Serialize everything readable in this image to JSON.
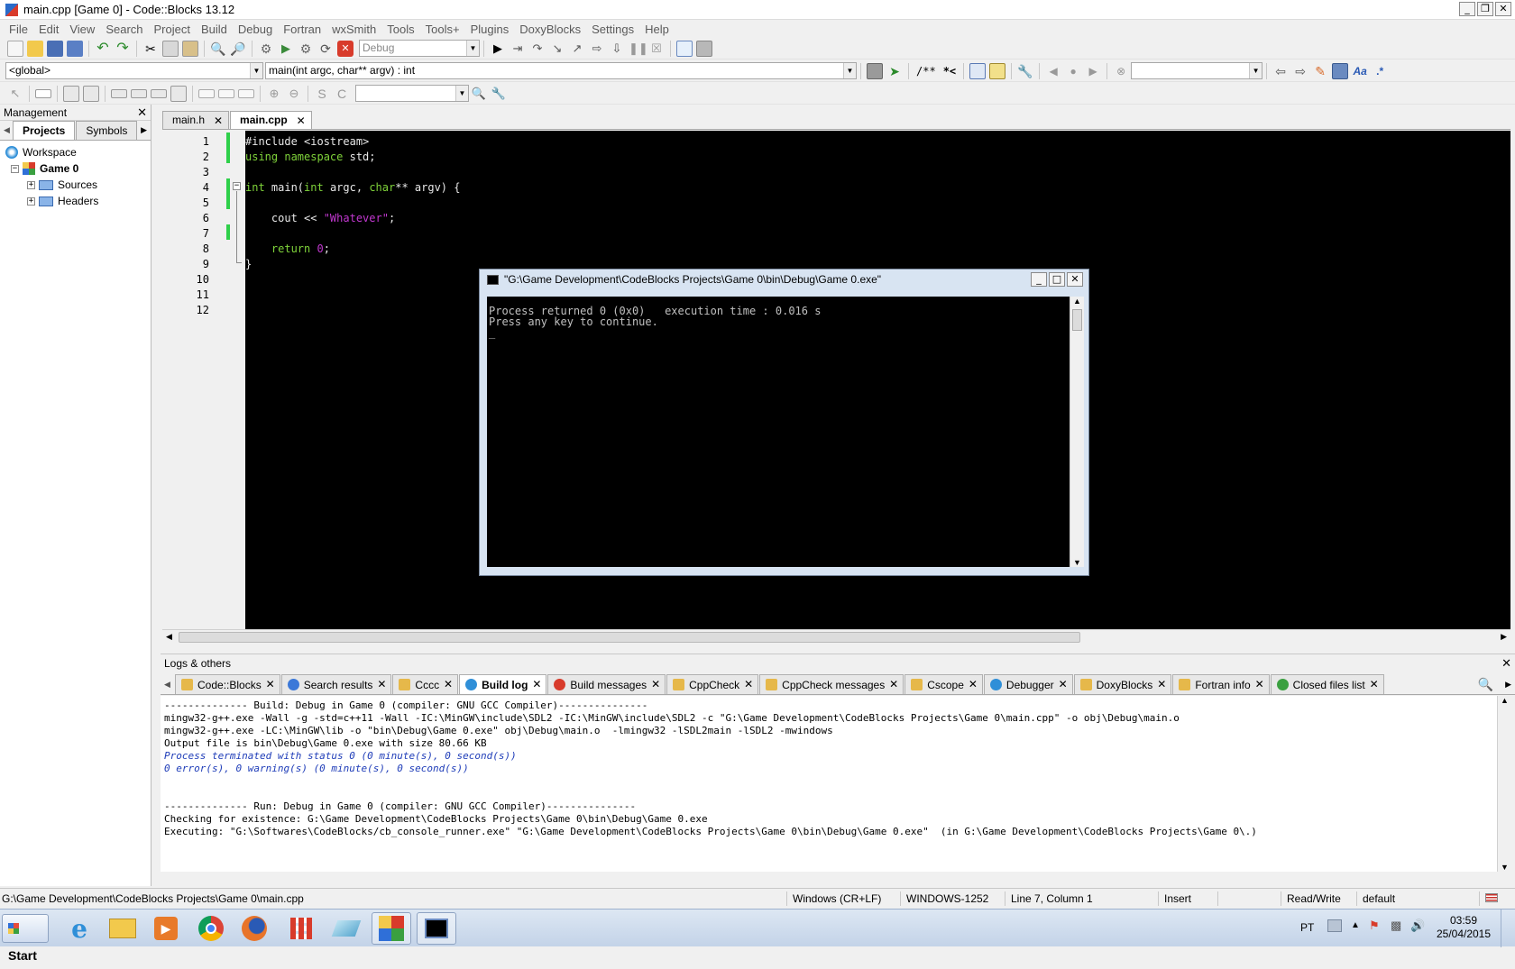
{
  "window": {
    "title": "main.cpp [Game 0] - Code::Blocks 13.12",
    "controls": [
      "_",
      "❐",
      "✕"
    ]
  },
  "menu": [
    "File",
    "Edit",
    "View",
    "Search",
    "Project",
    "Build",
    "Debug",
    "Fortran",
    "wxSmith",
    "Tools",
    "Tools+",
    "Plugins",
    "DoxyBlocks",
    "Settings",
    "Help"
  ],
  "toolbar": {
    "build_target": "Debug",
    "scope": "<global>",
    "function": "main(int argc, char** argv) : int",
    "comment_block": "/**",
    "comment_line": "*<",
    "search_value": "",
    "widget_value": ""
  },
  "management": {
    "title": "Management",
    "close": "✕",
    "tabs": [
      "Projects",
      "Symbols"
    ],
    "active_tab": "Projects",
    "tree": {
      "workspace": "Workspace",
      "project": "Game 0",
      "folders": [
        "Sources",
        "Headers"
      ]
    }
  },
  "editor": {
    "tabs": [
      {
        "label": "main.h",
        "active": false
      },
      {
        "label": "main.cpp",
        "active": true
      }
    ],
    "line_numbers": [
      "1",
      "2",
      "3",
      "4",
      "5",
      "6",
      "7",
      "8",
      "9",
      "10",
      "11",
      "12"
    ],
    "code": {
      "l1": "#include <iostream>",
      "l2_kw": "using namespace",
      "l2_rest": " std;",
      "l4_kw1": "int",
      "l4_a": " main(",
      "l4_kw2": "int",
      "l4_b": " argc, ",
      "l4_kw3": "char",
      "l4_c": "** argv) {",
      "l6_a": "    cout << ",
      "l6_str": "\"Whatever\"",
      "l6_b": ";",
      "l8_kw": "    return",
      "l8_num": " 0",
      "l8_b": ";",
      "l9": "}"
    }
  },
  "console": {
    "title": "\"G:\\Game Development\\CodeBlocks Projects\\Game 0\\bin\\Debug\\Game 0.exe\"",
    "line1": "Process returned 0 (0x0)   execution time : 0.016 s",
    "line2": "Press any key to continue.",
    "cursor": "_"
  },
  "logs": {
    "title": "Logs & others",
    "close": "✕",
    "tabs": [
      {
        "label": "Code::Blocks",
        "icon": "edit-icon",
        "color": "#e6b84a",
        "active": false
      },
      {
        "label": "Search results",
        "icon": "search-icon",
        "color": "#3b78d8",
        "active": false
      },
      {
        "label": "Cccc",
        "icon": "edit-icon",
        "color": "#e6b84a",
        "active": false
      },
      {
        "label": "Build log",
        "icon": "gear-icon",
        "color": "#2f8fd8",
        "active": true
      },
      {
        "label": "Build messages",
        "icon": "pin-icon",
        "color": "#d83b2b",
        "active": false
      },
      {
        "label": "CppCheck",
        "icon": "edit-icon",
        "color": "#e6b84a",
        "active": false
      },
      {
        "label": "CppCheck messages",
        "icon": "edit-icon",
        "color": "#e6b84a",
        "active": false
      },
      {
        "label": "Cscope",
        "icon": "edit-icon",
        "color": "#e6b84a",
        "active": false
      },
      {
        "label": "Debugger",
        "icon": "gear-icon",
        "color": "#2f8fd8",
        "active": false
      },
      {
        "label": "DoxyBlocks",
        "icon": "edit-icon",
        "color": "#e6b84a",
        "active": false
      },
      {
        "label": "Fortran info",
        "icon": "edit-icon",
        "color": "#e6b84a",
        "active": false
      },
      {
        "label": "Closed files list",
        "icon": "refresh-icon",
        "color": "#3aa040",
        "active": false
      }
    ],
    "lines": [
      {
        "text": "-------------- Build: Debug in Game 0 (compiler: GNU GCC Compiler)---------------",
        "style": "normal"
      },
      {
        "text": "mingw32-g++.exe -Wall -g -std=c++11 -Wall -IC:\\MinGW\\include\\SDL2 -IC:\\MinGW\\include\\SDL2 -c \"G:\\Game Development\\CodeBlocks Projects\\Game 0\\main.cpp\" -o obj\\Debug\\main.o",
        "style": "normal"
      },
      {
        "text": "mingw32-g++.exe -LC:\\MinGW\\lib -o \"bin\\Debug\\Game 0.exe\" obj\\Debug\\main.o  -lmingw32 -lSDL2main -lSDL2 -mwindows",
        "style": "normal"
      },
      {
        "text": "Output file is bin\\Debug\\Game 0.exe with size 80.66 KB",
        "style": "normal"
      },
      {
        "text": "Process terminated with status 0 (0 minute(s), 0 second(s))",
        "style": "hi"
      },
      {
        "text": "0 error(s), 0 warning(s) (0 minute(s), 0 second(s))",
        "style": "hi"
      },
      {
        "text": "",
        "style": "normal"
      },
      {
        "text": "",
        "style": "normal"
      },
      {
        "text": "-------------- Run: Debug in Game 0 (compiler: GNU GCC Compiler)---------------",
        "style": "normal"
      },
      {
        "text": "Checking for existence: G:\\Game Development\\CodeBlocks Projects\\Game 0\\bin\\Debug\\Game 0.exe",
        "style": "normal"
      },
      {
        "text": "Executing: \"G:\\Softwares\\CodeBlocks/cb_console_runner.exe\" \"G:\\Game Development\\CodeBlocks Projects\\Game 0\\bin\\Debug\\Game 0.exe\"  (in G:\\Game Development\\CodeBlocks Projects\\Game 0\\.)",
        "style": "normal"
      }
    ]
  },
  "statusbar": {
    "path": "G:\\Game Development\\CodeBlocks Projects\\Game 0\\main.cpp",
    "eol": "Windows (CR+LF)",
    "encoding": "WINDOWS-1252",
    "position": "Line 7, Column 1",
    "mode": "Insert",
    "access": "Read/Write",
    "profile": "default"
  },
  "taskbar": {
    "start": "Start",
    "language": "PT",
    "time": "03:59",
    "date": "25/04/2015"
  }
}
